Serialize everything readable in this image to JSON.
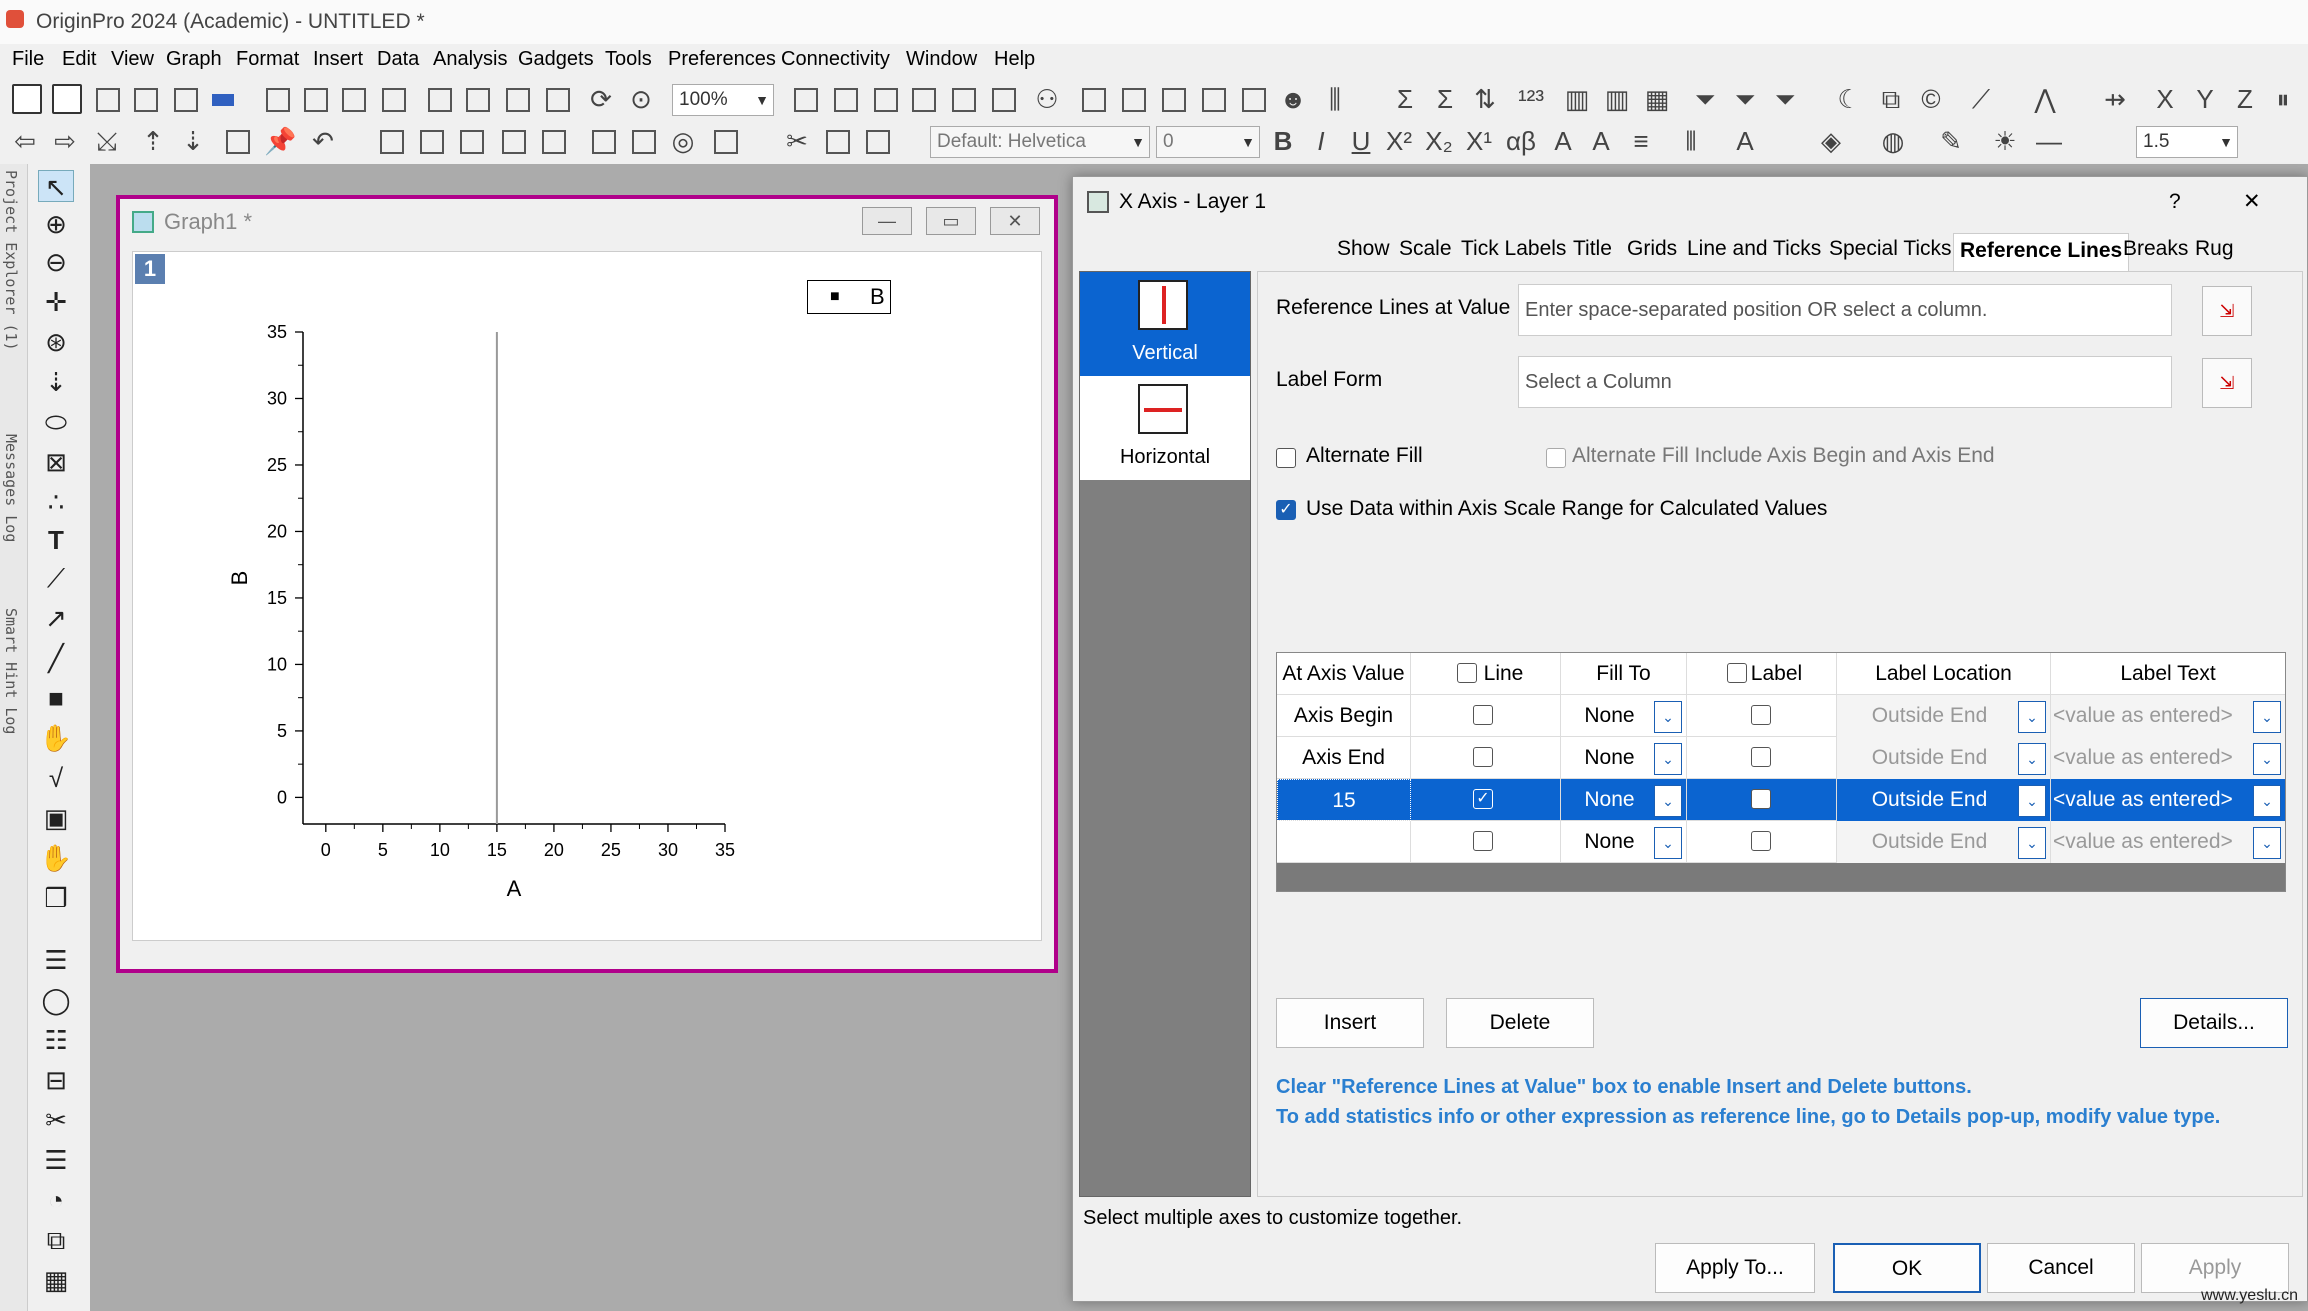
{
  "app": {
    "title": "OriginPro 2024 (Academic) - UNTITLED *"
  },
  "menu": [
    "File",
    "Edit",
    "View",
    "Graph",
    "Format",
    "Insert",
    "Data",
    "Analysis",
    "Gadgets",
    "Tools",
    "Preferences",
    "Connectivity",
    "Window",
    "Help"
  ],
  "toolbar": {
    "zoom_value": "100%",
    "font_name": "Default: Helvetica",
    "font_size": "0",
    "line_width": "1.5"
  },
  "left_tabs": [
    "Project Explorer (1)",
    "Messages Log",
    "Smart Hint Log"
  ],
  "graph_window": {
    "title": "Graph1 *",
    "layer_badge": "1",
    "legend_label": "B",
    "chart_data": {
      "type": "line",
      "xlabel": "A",
      "ylabel": "B",
      "xlim": [
        -2,
        35
      ],
      "ylim": [
        -2,
        35
      ],
      "x_ticks": [
        0,
        5,
        10,
        15,
        20,
        25,
        30,
        35
      ],
      "y_ticks": [
        0,
        5,
        10,
        15,
        20,
        25,
        30,
        35
      ],
      "reference_lines": [
        {
          "axis": "x",
          "value": 15
        }
      ],
      "series": [
        {
          "name": "B",
          "values": []
        }
      ],
      "legend": "top-right"
    }
  },
  "dialog": {
    "title": "X Axis - Layer 1",
    "help": "?",
    "close": "✕",
    "tabs": [
      "Show",
      "Scale",
      "Tick Labels",
      "Title",
      "Grids",
      "Line and Ticks",
      "Special Ticks",
      "Reference Lines",
      "Breaks",
      "Rug"
    ],
    "active_tab": "Reference Lines",
    "sidebar": [
      {
        "label": "Vertical",
        "selected": true
      },
      {
        "label": "Horizontal",
        "selected": false
      }
    ],
    "ref_lines_label": "Reference Lines at Value",
    "ref_lines_placeholder": "Enter space-separated position OR select a column.",
    "label_form_label": "Label Form",
    "label_form_placeholder": "Select a Column",
    "alternate_fill": "Alternate Fill",
    "alternate_fill_include": "Alternate Fill Include Axis Begin and Axis End",
    "use_data_within": "Use Data within Axis Scale Range for Calculated Values",
    "grid_headers": [
      "At Axis Value",
      "Line",
      "Fill To",
      "Label",
      "Label Location",
      "Label Text"
    ],
    "grid_rows": [
      {
        "value": "Axis Begin",
        "line": false,
        "fill": "None",
        "label": false,
        "location": "Outside End",
        "text": "<value as entered>"
      },
      {
        "value": "Axis End",
        "line": false,
        "fill": "None",
        "label": false,
        "location": "Outside End",
        "text": "<value as entered>"
      },
      {
        "value": "15",
        "line": true,
        "fill": "None",
        "label": false,
        "location": "Outside End",
        "text": "<value as entered>"
      },
      {
        "value": "",
        "line": false,
        "fill": "None",
        "label": false,
        "location": "Outside End",
        "text": "<value as entered>"
      }
    ],
    "insert_label": "Insert",
    "delete_label": "Delete",
    "details_label": "Details...",
    "info_line1": "Clear \"Reference Lines at Value\" box to enable Insert and Delete buttons.",
    "info_line2": "To add statistics info or other expression as reference line, go to Details pop-up, modify value type.",
    "status": "Select multiple axes to customize together.",
    "apply_to_label": "Apply To...",
    "ok_label": "OK",
    "cancel_label": "Cancel",
    "apply_label": "Apply"
  },
  "watermark": "www.yeslu.cn"
}
